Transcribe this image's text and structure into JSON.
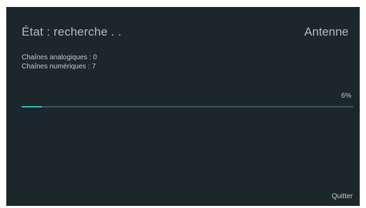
{
  "header": {
    "status": "État : recherche . .",
    "source": "Antenne"
  },
  "counts": {
    "analog": "Chaînes analogiques : 0",
    "digital": "Chaînes numériques : 7"
  },
  "progress": {
    "label": "6%",
    "fraction": 0.06
  },
  "actions": {
    "quit_label": "Quitter"
  },
  "colors": {
    "background": "#1c272c",
    "accent": "#27c4bd",
    "track": "#44545b"
  }
}
